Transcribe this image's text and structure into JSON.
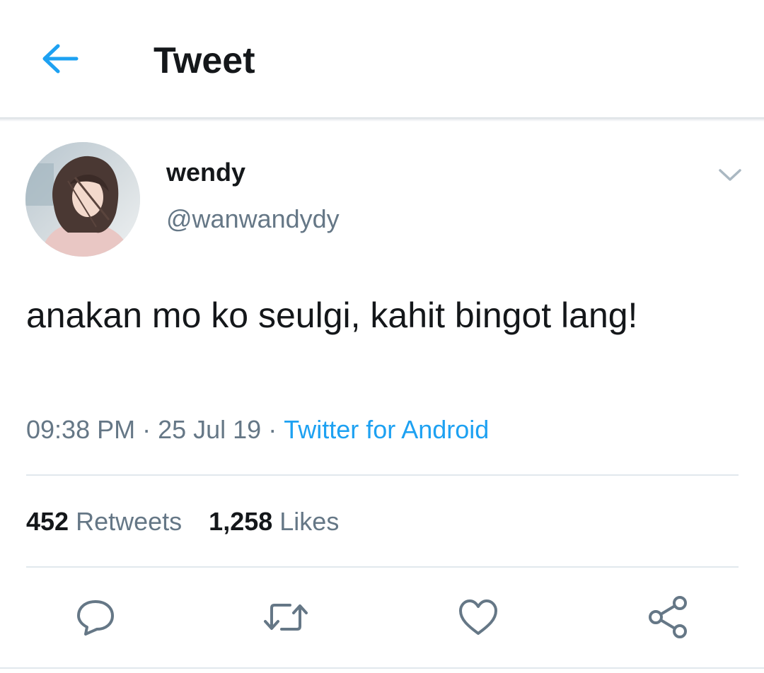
{
  "header": {
    "title": "Tweet",
    "back_icon": "arrow-left-icon"
  },
  "tweet": {
    "author": {
      "display_name": "wendy",
      "handle": "@wanwandydy",
      "avatar_icon": "avatar-photo"
    },
    "text": "anakan mo ko seulgi, kahit bingot lang!",
    "time": "09:38 PM",
    "date": "25 Jul 19",
    "separator": "·",
    "source": "Twitter for Android",
    "stats": {
      "retweets_count": "452",
      "retweets_label": "Retweets",
      "likes_count": "1,258",
      "likes_label": "Likes"
    },
    "actions": [
      "reply-icon",
      "retweet-icon",
      "like-icon",
      "share-icon"
    ]
  },
  "colors": {
    "accent": "#1da1f2",
    "text_primary": "#14171a",
    "text_secondary": "#657786",
    "divider": "#e1e8ed",
    "icon_gray": "#657786"
  }
}
